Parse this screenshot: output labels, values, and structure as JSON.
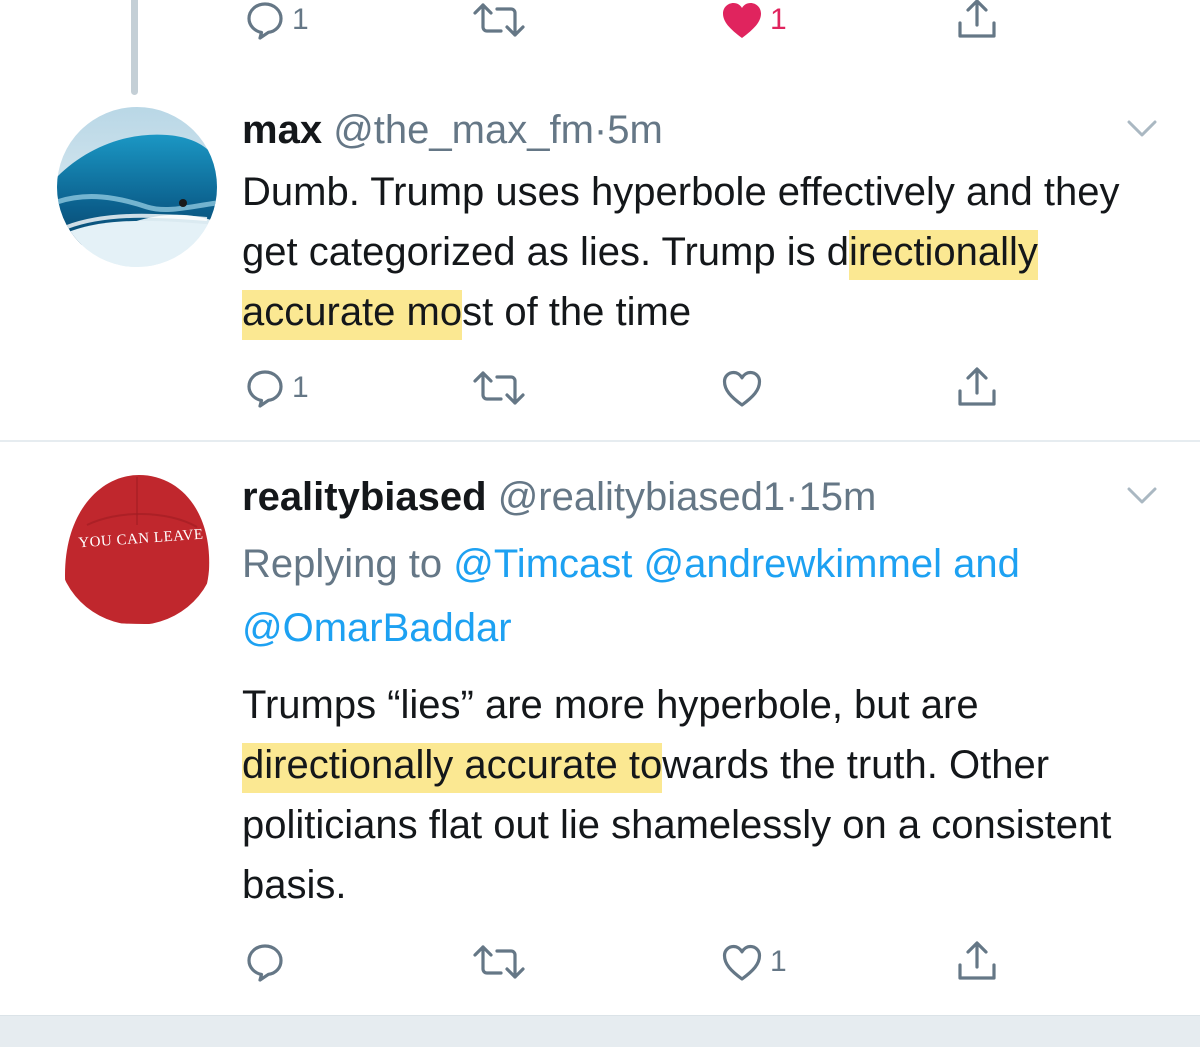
{
  "prev_tweet_actions": {
    "reply_count": "1",
    "retweet_count": "",
    "like_count": "1",
    "liked": true
  },
  "tweet1": {
    "name": "max",
    "handle": "@the_max_fm",
    "separator": "·",
    "time": "5m",
    "text_before": "Dumb. Trump uses hyperbole effectively and they get categorized as lies. Trump is d",
    "text_highlight": "irectionally accurate mo",
    "text_after": "st of the time",
    "reply_count": "1",
    "retweet_count": "",
    "like_count": ""
  },
  "tweet2": {
    "name": "realitybiased",
    "handle": "@realitybiased1",
    "separator": "·",
    "time": "15m",
    "avatar_hat_text": "YOU CAN LEAVE",
    "replying_prefix": "Replying to",
    "mention1": "@Timcast",
    "mention2": "@andrewkimmel",
    "replying_and": "and",
    "mention3": "@OmarBaddar",
    "text_before": "Trumps “lies” are more hyperbole, but are ",
    "text_highlight": "directionally accurate to",
    "text_after": "wards the truth. Other politicians flat out lie shamelessly on a consistent basis.",
    "reply_count": "",
    "retweet_count": "",
    "like_count": "1"
  },
  "colors": {
    "text": "#14171a",
    "secondary": "#657786",
    "link": "#1da1f2",
    "like": "#e0245e",
    "highlight": "#fae06e",
    "divider": "#e6ecf0"
  }
}
